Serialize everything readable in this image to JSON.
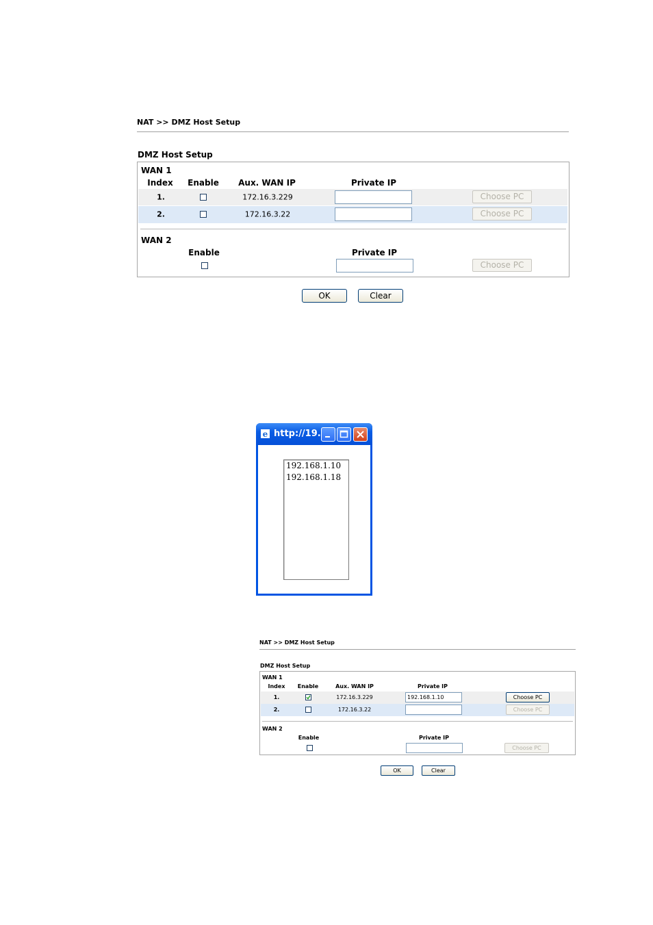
{
  "panel1": {
    "breadcrumb": "NAT >> DMZ Host Setup",
    "section_title": "DMZ Host Setup",
    "wan1": {
      "label": "WAN 1",
      "headers": {
        "index": "Index",
        "enable": "Enable",
        "aux_ip": "Aux. WAN IP",
        "private_ip": "Private IP"
      },
      "rows": [
        {
          "index": "1.",
          "enabled": false,
          "aux_ip": "172.16.3.229",
          "private_ip": "",
          "choose_pc": "Choose PC",
          "choose_pc_enabled": false
        },
        {
          "index": "2.",
          "enabled": false,
          "aux_ip": "172.16.3.22",
          "private_ip": "",
          "choose_pc": "Choose PC",
          "choose_pc_enabled": false
        }
      ]
    },
    "wan2": {
      "label": "WAN 2",
      "headers": {
        "enable": "Enable",
        "private_ip": "Private IP"
      },
      "enabled": false,
      "private_ip": "",
      "choose_pc": "Choose PC",
      "choose_pc_enabled": false
    },
    "buttons": {
      "ok": "OK",
      "clear": "Clear"
    }
  },
  "popup": {
    "title": "http://19...",
    "list_items": [
      "192.168.1.10",
      "192.168.1.18"
    ]
  },
  "panel2": {
    "breadcrumb": "NAT >> DMZ Host Setup",
    "section_title": "DMZ Host Setup",
    "wan1": {
      "label": "WAN 1",
      "headers": {
        "index": "Index",
        "enable": "Enable",
        "aux_ip": "Aux. WAN IP",
        "private_ip": "Private IP"
      },
      "rows": [
        {
          "index": "1.",
          "enabled": true,
          "aux_ip": "172.16.3.229",
          "private_ip": "192.168.1.10",
          "choose_pc": "Choose PC",
          "choose_pc_enabled": true
        },
        {
          "index": "2.",
          "enabled": false,
          "aux_ip": "172.16.3.22",
          "private_ip": "",
          "choose_pc": "Choose PC",
          "choose_pc_enabled": false
        }
      ]
    },
    "wan2": {
      "label": "WAN 2",
      "headers": {
        "enable": "Enable",
        "private_ip": "Private IP"
      },
      "enabled": false,
      "private_ip": "",
      "choose_pc": "Choose PC",
      "choose_pc_enabled": false
    },
    "buttons": {
      "ok": "OK",
      "clear": "Clear"
    }
  },
  "colors": {
    "row_odd": "#efefef",
    "row_even": "#dde9f7",
    "titlebar": "#0a5ce4",
    "checkmark": "#21a121"
  }
}
